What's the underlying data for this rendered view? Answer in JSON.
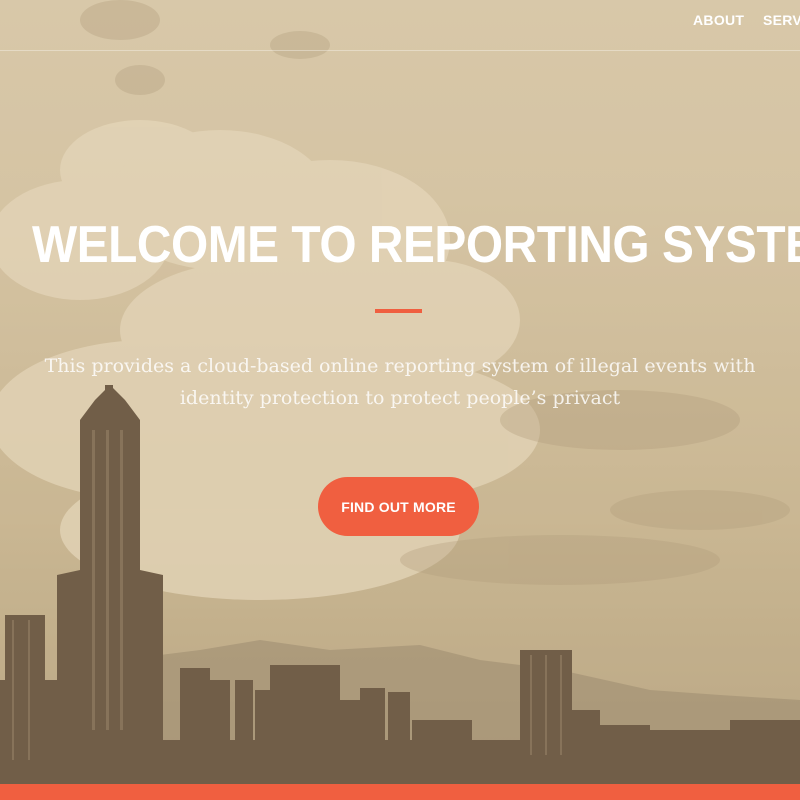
{
  "nav": {
    "items": [
      {
        "label": "ABOUT"
      },
      {
        "label": "SERVIC"
      }
    ]
  },
  "hero": {
    "title": "WELCOME TO REPORTING SYSTEM",
    "subtitle": "This provides a cloud-based online reporting system of illegal events with identity protection to protect people’s privact",
    "cta_label": "FIND OUT MORE"
  },
  "colors": {
    "accent": "#f05f40",
    "text": "#ffffff",
    "background_tint": "#d6c7a9"
  }
}
